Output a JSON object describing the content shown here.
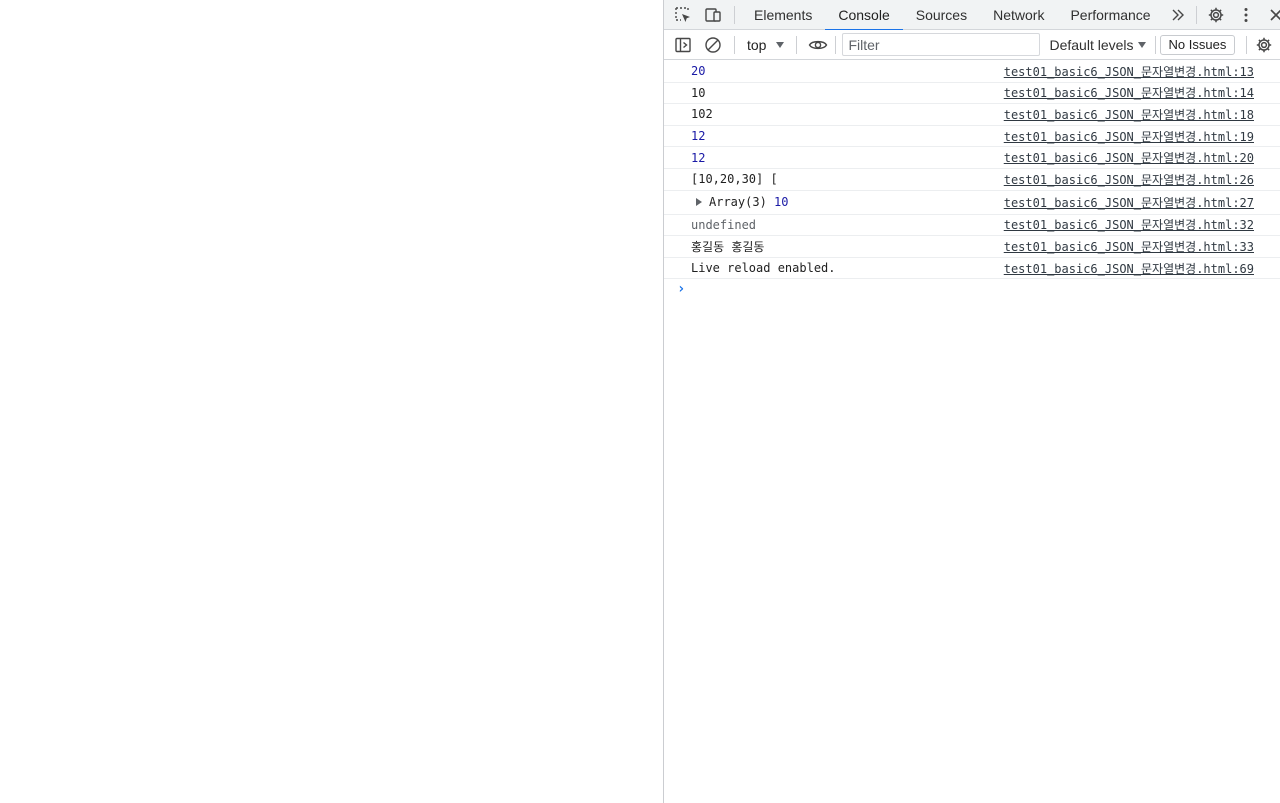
{
  "devtools": {
    "tabs": [
      {
        "label": "Elements",
        "active": false
      },
      {
        "label": "Console",
        "active": true
      },
      {
        "label": "Sources",
        "active": false
      },
      {
        "label": "Network",
        "active": false
      },
      {
        "label": "Performance",
        "active": false
      }
    ],
    "icons": {
      "inspect": "inspect-element-icon",
      "device": "device-toolbar-icon",
      "more_tabs": "chevron-double-right-icon",
      "settings": "gear-icon",
      "menu": "kebab-menu-icon",
      "close": "close-icon"
    }
  },
  "toolbar": {
    "context": "top",
    "filter_placeholder": "Filter",
    "levels_label": "Default levels",
    "issues_label": "No Issues"
  },
  "console": {
    "messages": [
      {
        "text": "20",
        "source": "test01_basic6_JSON_문자열변경.html:13"
      },
      {
        "text": "10",
        "source": "test01_basic6_JSON_문자열변경.html:14"
      },
      {
        "text": "102",
        "source": "test01_basic6_JSON_문자열변경.html:18"
      },
      {
        "text": "12",
        "source": "test01_basic6_JSON_문자열변경.html:19"
      },
      {
        "text": "12",
        "source": "test01_basic6_JSON_문자열변경.html:20"
      },
      {
        "text": "[10,20,30] [",
        "source": "test01_basic6_JSON_문자열변경.html:26"
      },
      {
        "text": "Array(3)",
        "extra": "10",
        "source": "test01_basic6_JSON_문자열변경.html:27"
      },
      {
        "text": "undefined",
        "source": "test01_basic6_JSON_문자열변경.html:32"
      },
      {
        "text": "홍길동 홍길동",
        "source": "test01_basic6_JSON_문자열변경.html:33"
      },
      {
        "text": "Live reload enabled.",
        "source": "test01_basic6_JSON_문자열변경.html:69"
      }
    ],
    "prompt": "›"
  },
  "colors": {
    "accent": "#1a73e8",
    "number": "#1a1aa6",
    "tabbar_bg": "#f1f3f4"
  }
}
